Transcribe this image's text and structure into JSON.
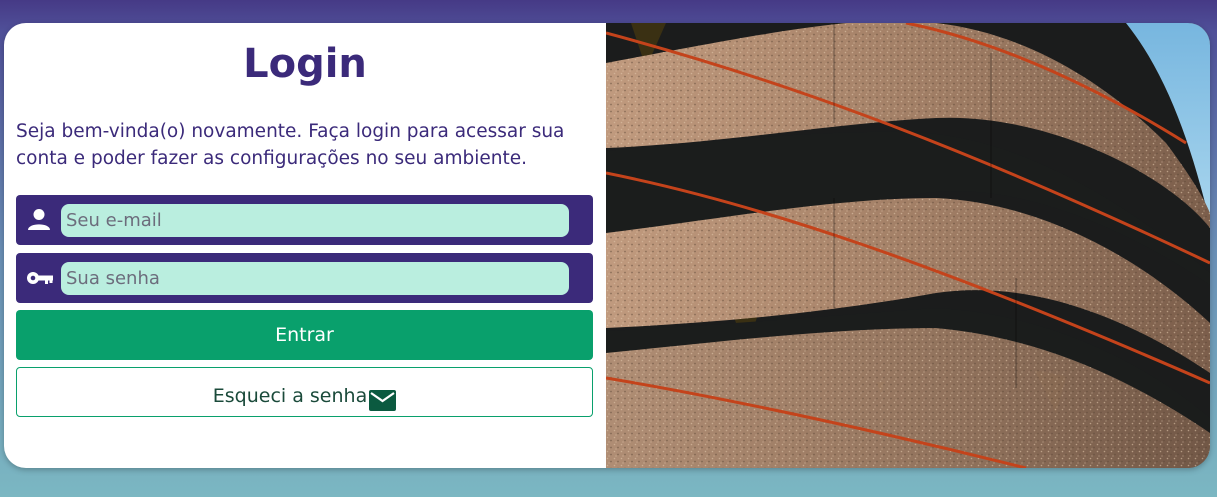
{
  "login": {
    "title": "Login",
    "description": "Seja bem-vinda(o) novamente. Faça login para acessar sua conta e poder fazer as configurações no seu ambiente.",
    "email_placeholder": "Seu e-mail",
    "password_placeholder": "Sua senha",
    "enter_label": "Entrar",
    "forgot_label": "Esqueci a senha"
  },
  "icons": {
    "email_field": "user-icon",
    "password_field": "key-icon",
    "forgot_button": "mail-icon"
  },
  "colors": {
    "primary": "#3b2a7a",
    "field_bg": "#baeedf",
    "accent": "#09a06c"
  }
}
